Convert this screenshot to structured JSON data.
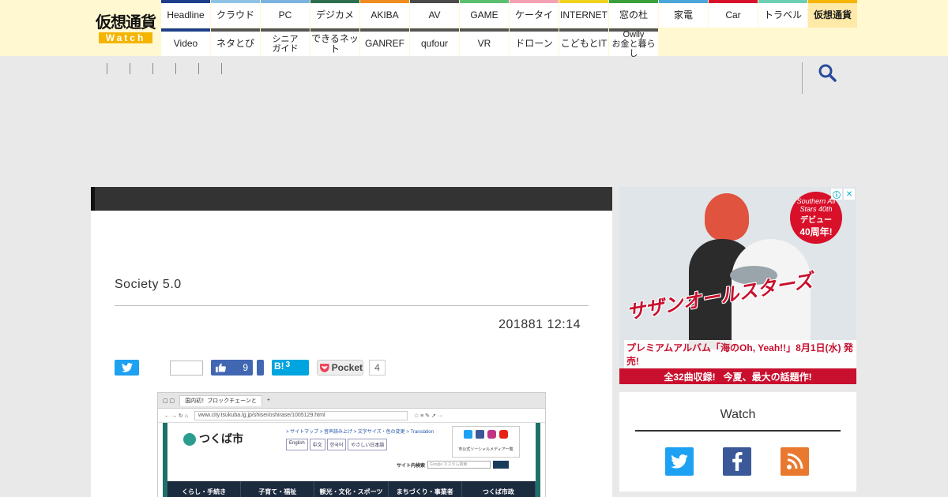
{
  "logo": {
    "text": "仮想通貨",
    "sub": "Watch"
  },
  "nav": {
    "row1": [
      {
        "label": "Headline",
        "color": "#1d3e8a"
      },
      {
        "label": "クラウド",
        "color": "#8ec3e6"
      },
      {
        "label": "PC",
        "color": "#7ab3e0"
      },
      {
        "label": "デジカメ",
        "color": "#2e6e50"
      },
      {
        "label": "AKIBA",
        "color": "#f08c1e"
      },
      {
        "label": "AV",
        "color": "#4a4a4a"
      },
      {
        "label": "GAME",
        "color": "#5ac070"
      },
      {
        "label": "ケータイ",
        "color": "#f4a0b4"
      },
      {
        "label": "INTERNET",
        "color": "#f0d21e"
      },
      {
        "label": "窓の杜",
        "color": "#3aa03a"
      },
      {
        "label": "家電",
        "color": "#4aa6d8"
      },
      {
        "label": "Car",
        "color": "#d8102a"
      },
      {
        "label": "トラベル",
        "color": "#6ccfb3"
      },
      {
        "label": "仮想通貨",
        "color": "#f4b400",
        "active": true
      }
    ],
    "row2": [
      {
        "label": "Video",
        "color": "#1d3e8a"
      },
      {
        "label": "ネタとぴ",
        "color": "#555555"
      },
      {
        "label": "シニア\nガイド",
        "color": "#555555"
      },
      {
        "label": "できるネット",
        "color": "#555555"
      },
      {
        "label": "GANREF",
        "color": "#555555"
      },
      {
        "label": "qufour",
        "color": "#555555"
      },
      {
        "label": "VR",
        "color": "#555555"
      },
      {
        "label": "ドローン",
        "color": "#555555"
      },
      {
        "label": "こどもとIT",
        "color": "#555555"
      },
      {
        "label": "Owlly\nお金と暮らし",
        "color": "#555555"
      }
    ]
  },
  "article": {
    "title": "Society 5.0",
    "date": "201881 12:14"
  },
  "share": {
    "facebook_count": "9",
    "hatena_label": "B!",
    "hatena_count": "3",
    "pocket_label": "Pocket",
    "pocket_count": "4"
  },
  "screenshot": {
    "tab_title": "国内初！ブロックチェーンと",
    "url": "www.city.tsukuba.lg.jp/shisei/oshirase/1005129.html",
    "site_name": "つくば市",
    "top_links": "> サイトマップ   > 音声読み上げ   > 文字サイズ・色の変更   > Translation",
    "languages": [
      "English",
      "中文",
      "한국어",
      "やさしい日本語"
    ],
    "social_caption": "市公式ソーシャルメディア一覧",
    "search_label": "サイト内検索",
    "search_placeholder": "Google カスタム検索",
    "menu": [
      "くらし・手続き",
      "子育て・福祉",
      "観光・文化・スポーツ",
      "まちづくり・事業者",
      "つくば市政"
    ]
  },
  "ad": {
    "badge_a": "Southern All Stars 40th",
    "badge_b": "デビュー",
    "badge_c": "40周年!",
    "title": "サザンオールスターズ",
    "line2": "プレミアムアルバム「海のOh, Yeah!!」8月1日(水) 発売!",
    "line3a": "全32曲収録!",
    "line3b": "今夏、最大の話題作!"
  },
  "widget": {
    "title": "Watch",
    "icons": [
      {
        "name": "twitter-icon",
        "color": "#1da1f2"
      },
      {
        "name": "facebook-icon",
        "color": "#3b5998"
      },
      {
        "name": "rss-icon",
        "color": "#e8792f"
      }
    ]
  }
}
